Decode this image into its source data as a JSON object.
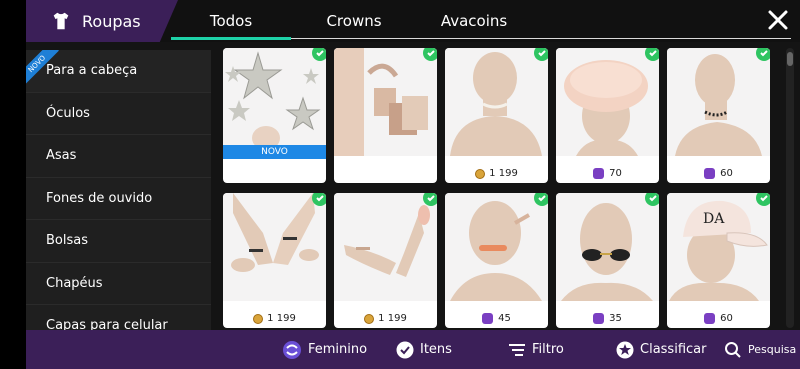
{
  "header": {
    "brand_label": "Roupas",
    "tabs": [
      {
        "label": "Todos",
        "active": true
      },
      {
        "label": "Crowns",
        "active": false
      },
      {
        "label": "Avacoins",
        "active": false
      }
    ]
  },
  "sidebar": {
    "badge": "NOVO",
    "items": [
      {
        "label": "Para a cabeça"
      },
      {
        "label": "Óculos"
      },
      {
        "label": "Asas"
      },
      {
        "label": "Fones de ouvido"
      },
      {
        "label": "Bolsas"
      },
      {
        "label": "Chapéus"
      },
      {
        "label": "Capas para celular"
      }
    ]
  },
  "items": [
    {
      "name": "stars",
      "price": "",
      "currency": "",
      "novo": "NOVO"
    },
    {
      "name": "shopping-bags",
      "price": "",
      "currency": ""
    },
    {
      "name": "choker-necklace",
      "price": "1 199",
      "currency": "avacoins"
    },
    {
      "name": "fur-headband",
      "price": "70",
      "currency": "crowns"
    },
    {
      "name": "beaded-choker",
      "price": "60",
      "currency": "crowns"
    },
    {
      "name": "bracelets-crossed-arms",
      "price": "1 199",
      "currency": "avacoins"
    },
    {
      "name": "bracelets-open-hands",
      "price": "1 199",
      "currency": "avacoins"
    },
    {
      "name": "pacifier-face",
      "price": "45",
      "currency": "crowns"
    },
    {
      "name": "sunglasses",
      "price": "35",
      "currency": "crowns"
    },
    {
      "name": "cap",
      "price": "60",
      "currency": "crowns"
    }
  ],
  "bottom": {
    "gender": "Feminino",
    "items": "Itens",
    "filter": "Filtro",
    "sort": "Classificar",
    "search": "Pesquisa"
  },
  "colors": {
    "accent": "#1ed2a8",
    "purple": "#3b1f58",
    "check": "#2ec461",
    "novo": "#1e88e5"
  }
}
